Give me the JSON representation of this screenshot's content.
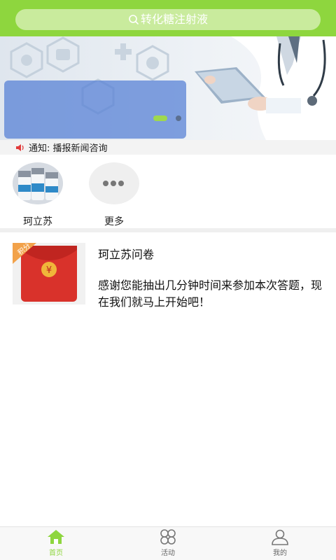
{
  "search": {
    "placeholder": "转化糖注射液"
  },
  "banner": {
    "slide_count": 2,
    "active_slide": 1
  },
  "notice": {
    "text": "通知: 播报新闻咨询"
  },
  "categories": [
    {
      "label": "珂立苏",
      "icon": "medicine-vials-image"
    },
    {
      "label": "更多",
      "icon": "more-dots-icon"
    }
  ],
  "card": {
    "badge": "积分",
    "title": "珂立苏问卷",
    "description": "感谢您能抽出几分钟时间来参加本次答题，现在我们就马上开始吧！"
  },
  "tabbar": {
    "items": [
      {
        "label": "首页",
        "icon": "home-icon",
        "active": true
      },
      {
        "label": "活动",
        "icon": "activity-grid-icon",
        "active": false
      },
      {
        "label": "我的",
        "icon": "user-icon",
        "active": false
      }
    ]
  },
  "colors": {
    "accent": "#8ed63e",
    "banner_overlay": "#5882d6",
    "red_packet": "#d9322b"
  }
}
